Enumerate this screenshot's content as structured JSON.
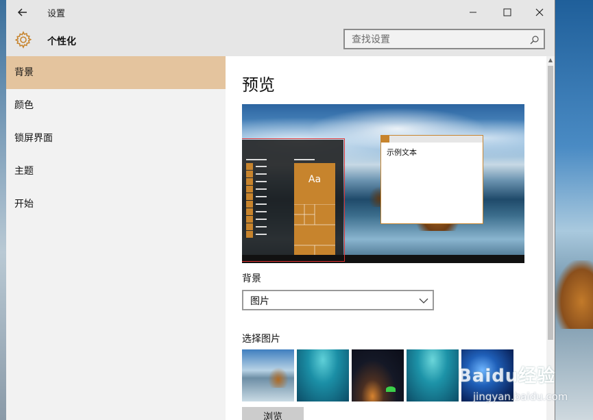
{
  "titlebar": {
    "title": "设置",
    "back_icon": "back-arrow-icon",
    "minimize_icon": "minimize-icon",
    "maximize_icon": "maximize-icon",
    "close_icon": "close-icon"
  },
  "header": {
    "title": "个性化",
    "icon": "gear-icon",
    "search_placeholder": "查找设置",
    "search_icon": "search-icon"
  },
  "sidebar": {
    "items": [
      {
        "label": "背景",
        "active": true
      },
      {
        "label": "颜色",
        "active": false
      },
      {
        "label": "锁屏界面",
        "active": false
      },
      {
        "label": "主题",
        "active": false
      },
      {
        "label": "开始",
        "active": false
      }
    ]
  },
  "main": {
    "preview_heading": "预览",
    "preview": {
      "start_tile_text": "Aa",
      "sample_window_text": "示例文本"
    },
    "background_label": "背景",
    "background_select_value": "图片",
    "choose_picture_label": "选择图片",
    "browse_label": "浏览"
  },
  "watermark": {
    "brand": "Baidu经验",
    "sub": "jingyan.baidu.com"
  },
  "colors": {
    "accent": "#c7842d",
    "nav_active": "#e4c49e",
    "titlebar_bg": "#e6e6e6",
    "sidebar_bg": "#f2f2f2"
  }
}
